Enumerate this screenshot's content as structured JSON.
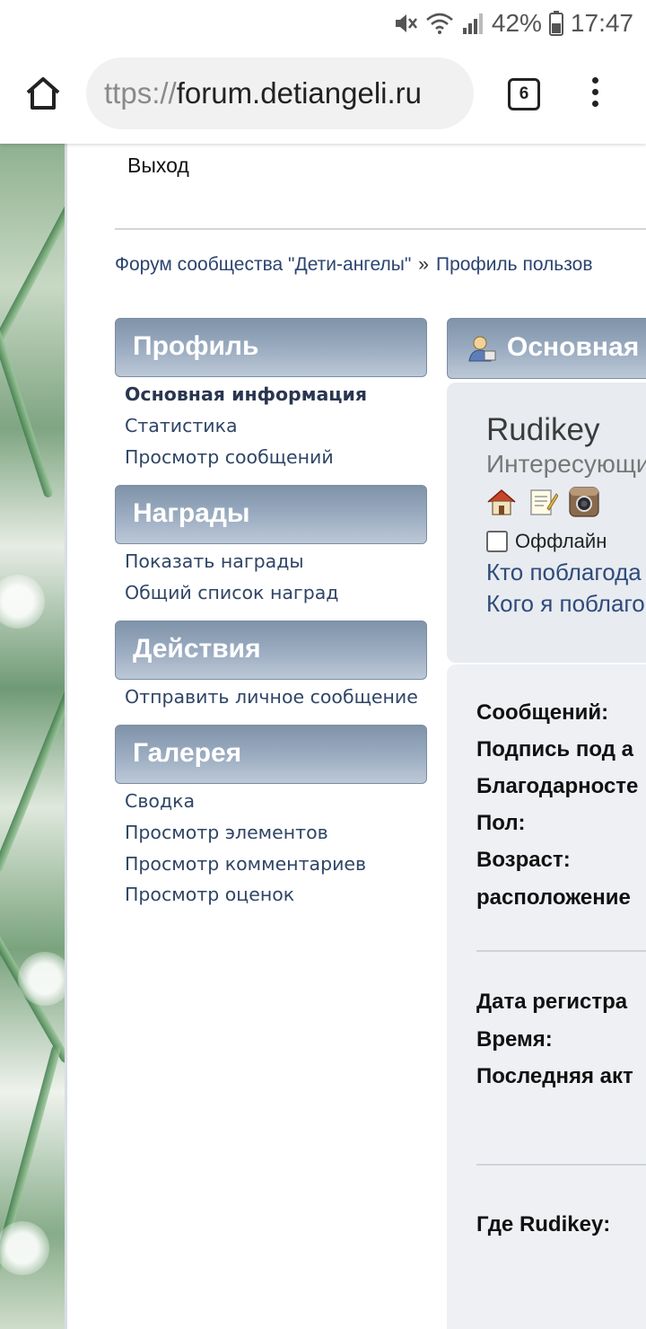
{
  "status_bar": {
    "battery_percent": "42%",
    "time": "17:47",
    "icons": [
      "mute-icon",
      "wifi-icon",
      "signal-icon",
      "battery-icon"
    ]
  },
  "browser": {
    "url_scheme": "ttps://",
    "url_host": "forum.detiangeli.ru",
    "tab_count": "6",
    "icons": [
      "home-icon",
      "tabs-icon",
      "menu-dots-icon"
    ]
  },
  "page": {
    "logout_label": "Выход",
    "breadcrumb": {
      "forum": "Форум сообщества \"Дети-ангелы\"",
      "separator": "»",
      "profile": "Профиль пользов"
    }
  },
  "sidebar": {
    "profile": {
      "title": "Профиль",
      "items": [
        "Основная информация",
        "Статистика",
        "Просмотр сообщений"
      ]
    },
    "awards": {
      "title": "Награды",
      "items": [
        "Показать награды",
        "Общий список наград"
      ]
    },
    "actions": {
      "title": "Действия",
      "items": [
        "Отправить личное сообщение"
      ]
    },
    "gallery": {
      "title": "Галерея",
      "items": [
        "Сводка",
        "Просмотр элементов",
        "Просмотр комментариев",
        "Просмотр оценок"
      ]
    }
  },
  "main": {
    "header": "Основная",
    "username": "Rudikey",
    "user_title": "Интересующи",
    "profile_icons": [
      "home-icon",
      "notepad-icon",
      "instagram-icon"
    ],
    "status": "Оффлайн",
    "thanked_by": "Кто поблагода",
    "thanked": "Кого я поблаго",
    "stats": {
      "posts": "Сообщений:",
      "signature": "Подпись под а",
      "thanks": "Благодарносте",
      "gender": "Пол:",
      "age": "Возраст:",
      "location": "расположение",
      "registered": "Дата регистра",
      "time": "Время:",
      "last_active": "Последняя акт",
      "where": "Где Rudikey:"
    }
  },
  "colors": {
    "header_gradient_top": "#7f93a9",
    "header_gradient_bottom": "#bcc8d6",
    "link": "#2f4566",
    "panel_bg": "#e8ebf0"
  }
}
